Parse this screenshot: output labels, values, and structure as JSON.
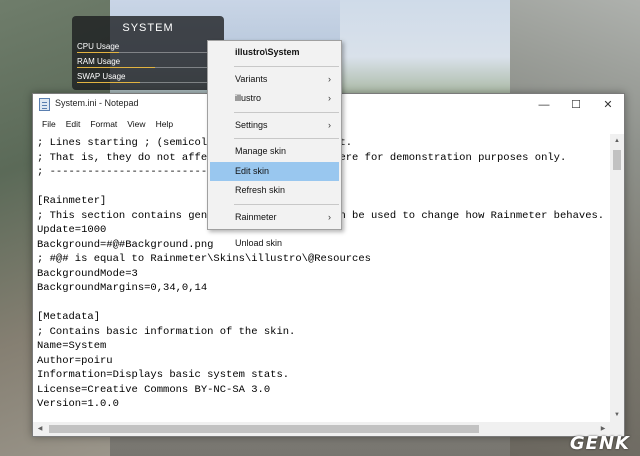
{
  "widget": {
    "title": "SYSTEM",
    "rows": [
      {
        "label": "CPU Usage",
        "level": 0.3
      },
      {
        "label": "RAM Usage",
        "level": 0.55
      },
      {
        "label": "SWAP Usage",
        "level": 0.45
      }
    ]
  },
  "notepad": {
    "title": "System.ini - Notepad",
    "menu": [
      "File",
      "Edit",
      "Format",
      "View",
      "Help"
    ],
    "lines": [
      "; Lines starting ; (semicolons) are commented out.",
      "; That is, they do not affect the code and are here for demonstration purposes only.",
      "; ----------------------------------",
      "",
      "[Rainmeter]",
      "; This section contains general settings that can be used to change how Rainmeter behaves.",
      "Update=1000",
      "Background=#@#Background.png",
      "; #@# is equal to Rainmeter\\Skins\\illustro\\@Resources",
      "BackgroundMode=3",
      "BackgroundMargins=0,34,0,14",
      "",
      "[Metadata]",
      "; Contains basic information of the skin.",
      "Name=System",
      "Author=poiru",
      "Information=Displays basic system stats.",
      "License=Creative Commons BY-NC-SA 3.0",
      "Version=1.0.0"
    ]
  },
  "context_menu": {
    "items": [
      {
        "label": "illustro\\System",
        "bold": true
      },
      {
        "separator": true
      },
      {
        "label": "Variants",
        "submenu": true
      },
      {
        "label": "illustro",
        "submenu": true
      },
      {
        "separator": true
      },
      {
        "label": "Settings",
        "submenu": true
      },
      {
        "separator": true
      },
      {
        "label": "Manage skin"
      },
      {
        "label": "Edit skin",
        "highlighted": true
      },
      {
        "label": "Refresh skin"
      },
      {
        "separator": true
      },
      {
        "label": "Rainmeter",
        "submenu": true
      },
      {
        "separator": true
      },
      {
        "label": "Unload skin"
      }
    ],
    "highlight_color": "#99c7ef"
  },
  "watermark": "GENK"
}
